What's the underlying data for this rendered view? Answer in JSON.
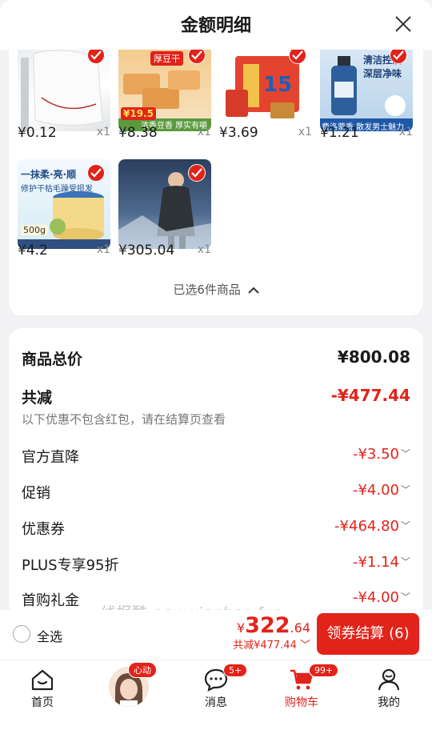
{
  "header": {
    "title": "金额明细"
  },
  "products": [
    {
      "price": "¥0.12",
      "qty": "x1"
    },
    {
      "price": "¥8.38",
      "qty": "x1"
    },
    {
      "price": "¥3.69",
      "qty": "x1"
    },
    {
      "price": "¥1.21",
      "qty": "x1"
    },
    {
      "price": "¥4.2",
      "qty": "x1"
    },
    {
      "price": "¥305.04",
      "qty": "x1"
    }
  ],
  "product_texts": {
    "snack_brand": "厚豆干",
    "snack_price_tag": "¥19.5",
    "snack_bottom": "浓香豆香 厚实有嚼",
    "face_wash_title": "清洁控油",
    "face_wash_sub": "深层净味",
    "face_wash_bottom": "费洛蒙香 散发男士魅力",
    "hair_title": "一抹柔·亮·顺",
    "hair_sub": "修护干枯毛躁受损发",
    "hair_weight": "500g"
  },
  "selected_info": "已选6件商品",
  "summary": {
    "total_label": "商品总价",
    "total_value": "¥800.08",
    "reduce_label": "共减",
    "reduce_value": "-¥477.44",
    "note": "以下优惠不包含红包，请在结算页查看",
    "items": [
      {
        "label": "官方直降",
        "value": "-¥3.50"
      },
      {
        "label": "促销",
        "value": "-¥4.00"
      },
      {
        "label": "优惠券",
        "value": "-¥464.80"
      },
      {
        "label": "PLUS专享95折",
        "value": "-¥1.14"
      },
      {
        "label": "首购礼金",
        "value": "-¥4.00"
      }
    ]
  },
  "watermark": "线报酷-new.xianbao.fun",
  "footer": {
    "select_all": "全选",
    "currency": "¥",
    "amount_int": "322",
    "amount_dec": ".64",
    "saved": "共减¥477.44",
    "checkout": "领券结算 (6)"
  },
  "tabbar": [
    {
      "label": "首页"
    },
    {
      "label": "",
      "badge": "心动"
    },
    {
      "label": "消息",
      "badge": "5+"
    },
    {
      "label": "购物车",
      "badge": "99+"
    },
    {
      "label": "我的"
    }
  ],
  "colors": {
    "accent": "#e2231a",
    "background": "#f2f2f4"
  }
}
